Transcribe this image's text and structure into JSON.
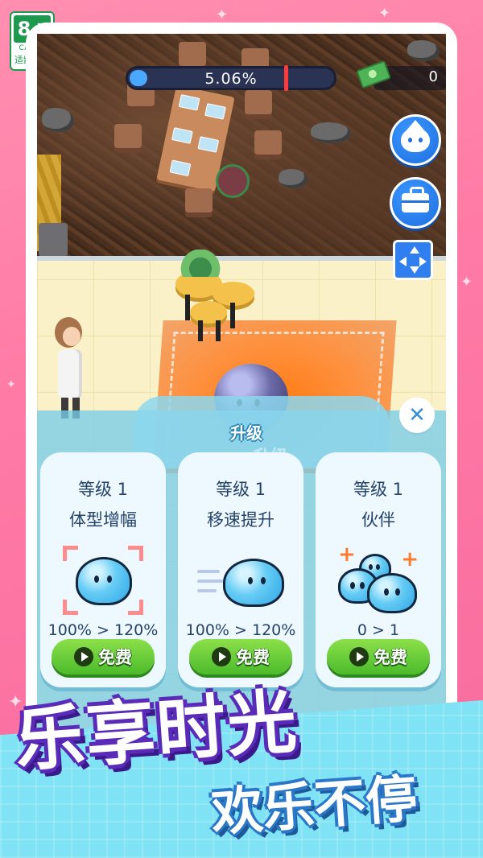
{
  "age_rating": {
    "age": "8+",
    "org": "CADPA",
    "tip": "适龄提示"
  },
  "hud": {
    "progress_text": "5.06%",
    "progress_value": 0.0506,
    "money": "0"
  },
  "upgrade_panel": {
    "title": "升级",
    "watermark": "升级",
    "cards": [
      {
        "level": "等级 1",
        "name": "体型增幅",
        "stat": "100% > 120%",
        "button": "免费",
        "icon": "slime-grow-icon"
      },
      {
        "level": "等级 1",
        "name": "移速提升",
        "stat": "100% > 120%",
        "button": "免费",
        "icon": "slime-speed-icon"
      },
      {
        "level": "等级 1",
        "name": "伙伴",
        "stat": "0 > 1",
        "button": "免费",
        "icon": "slime-partner-icon"
      }
    ]
  },
  "side_buttons": [
    "crown-slime-icon",
    "toolbox-icon",
    "move-arrows-icon"
  ],
  "banner": {
    "main": "乐享时光",
    "sub": "欢乐不停"
  },
  "colors": {
    "background": "#ff7aa6",
    "panel": "#78cde8",
    "button_green": "#4cbb2b",
    "hud_blue": "#1f6fe0"
  }
}
